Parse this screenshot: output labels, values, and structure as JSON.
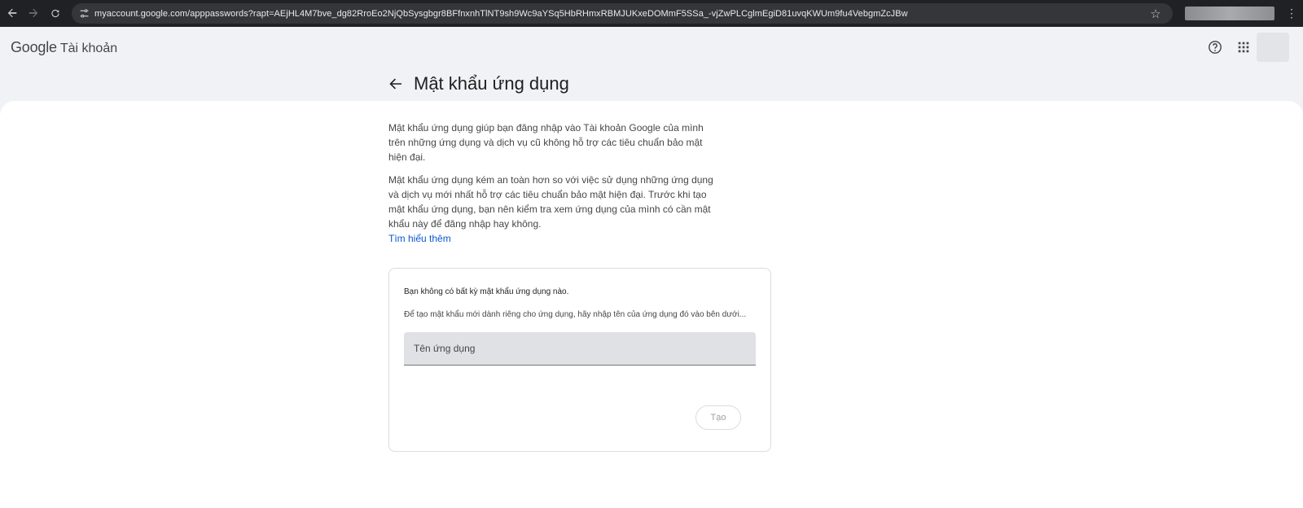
{
  "browser": {
    "url": "myaccount.google.com/apppasswords?rapt=AEjHL4M7bve_dg82RroEo2NjQbSysgbgr8BFfnxnhTlNT9sh9Wc9aYSq5HbRHmxRBMJUKxeDOMmF5SSa_-vjZwPLCglmEgiD81uvqKWUm9fu4VebgmZcJBw",
    "icons": [
      "back-arrow-icon",
      "forward-arrow-icon",
      "reload-icon",
      "tune-icon",
      "star-icon",
      "more-vert-icon"
    ]
  },
  "header": {
    "brand_google": "Google",
    "brand_product": "Tài khoản",
    "icons": [
      "help-icon",
      "apps-grid-icon"
    ]
  },
  "page": {
    "title": "Mật khẩu ứng dụng",
    "intro_1": "Mật khẩu ứng dụng giúp bạn đăng nhập vào Tài khoản Google của mình trên những ứng dụng và dịch vụ cũ không hỗ trợ các tiêu chuẩn bảo mật hiện đại.",
    "intro_2": "Mật khẩu ứng dụng kém an toàn hơn so với việc sử dụng những ứng dụng và dịch vụ mới nhất hỗ trợ các tiêu chuẩn bảo mật hiện đại. Trước khi tạo mật khẩu ứng dụng, bạn nên kiểm tra xem ứng dụng của mình có cần mật khẩu này để đăng nhập hay không.",
    "learn_more": "Tìm hiểu thêm"
  },
  "card": {
    "empty_message": "Bạn không có bất kỳ mật khẩu ứng dụng nào.",
    "hint": "Để tạo mật khẩu mới dành riêng cho ứng dụng, hãy nhập tên của ứng dụng đó vào bên dưới...",
    "input_placeholder": "Tên ứng dụng",
    "input_value": "",
    "create_label": "Tạo"
  }
}
